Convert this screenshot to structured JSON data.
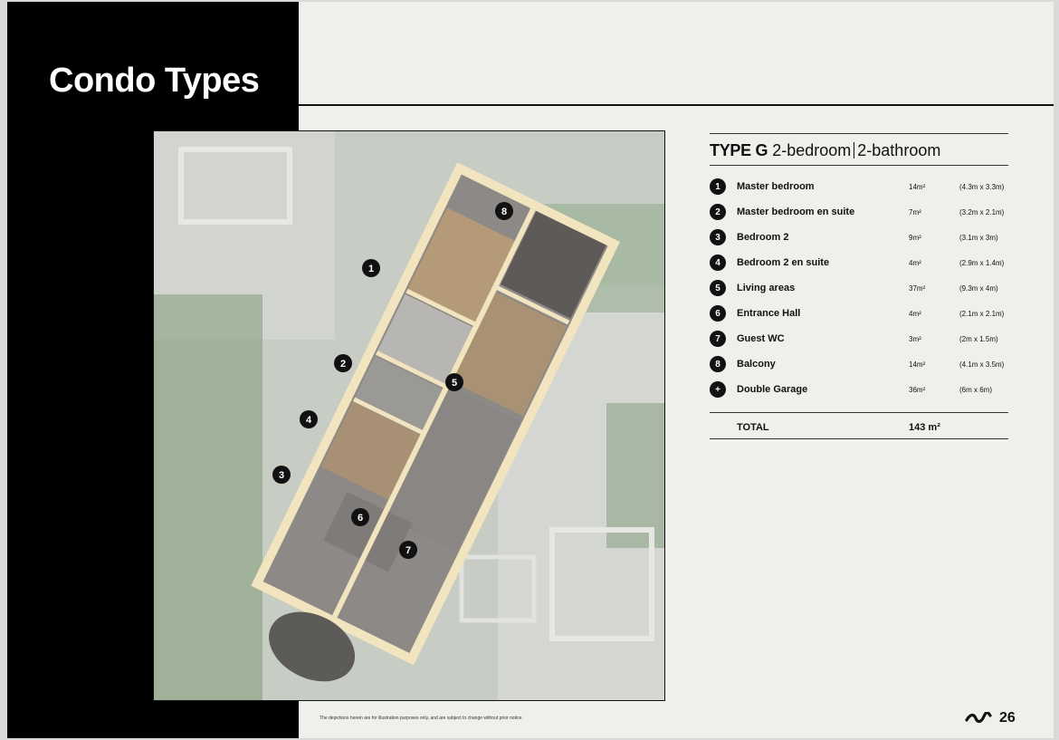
{
  "title": "Condo Types",
  "unit": {
    "type_name": "TYPE G",
    "bedrooms": "2-bedroom",
    "bathrooms": "2-bathroom"
  },
  "rooms": [
    {
      "marker": "1",
      "name": "Master bedroom",
      "area": "14m²",
      "dims": "(4.3m x 3.3m)"
    },
    {
      "marker": "2",
      "name": "Master bedroom en suite",
      "area": "7m²",
      "dims": "(3.2m x 2.1m)"
    },
    {
      "marker": "3",
      "name": "Bedroom 2",
      "area": "9m²",
      "dims": "(3.1m x 3m)"
    },
    {
      "marker": "4",
      "name": "Bedroom 2 en suite",
      "area": "4m²",
      "dims": "(2.9m x 1.4m)"
    },
    {
      "marker": "5",
      "name": "Living areas",
      "area": "37m²",
      "dims": "(9.3m x 4m)"
    },
    {
      "marker": "6",
      "name": "Entrance Hall",
      "area": "4m²",
      "dims": "(2.1m x 2.1m)"
    },
    {
      "marker": "7",
      "name": "Guest WC",
      "area": "3m²",
      "dims": "(2m x 1.5m)"
    },
    {
      "marker": "8",
      "name": "Balcony",
      "area": "14m²",
      "dims": "(4.1m x 3.5m)"
    },
    {
      "marker": "+",
      "name": "Double Garage",
      "area": "36m²",
      "dims": "(6m x 6m)"
    }
  ],
  "total": {
    "label": "TOTAL",
    "value": "143 m²"
  },
  "disclaimer": "The depictions herein are for illustration purposes only, and are subject to change without prior notice.",
  "page_number": "26",
  "colors": {
    "panel": "#000000",
    "page": "#efefeb",
    "wall": "#f2e4bf"
  }
}
